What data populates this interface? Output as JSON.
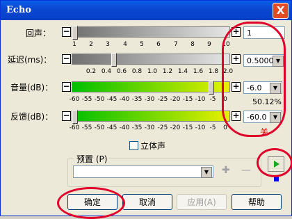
{
  "window": {
    "title": "Echo",
    "close_glyph": "X"
  },
  "rows": {
    "echo": {
      "label": "回声：",
      "value": "1",
      "scale": [
        "1",
        "2",
        "3",
        "4",
        "5",
        "6",
        "7",
        "8",
        "9",
        "10"
      ]
    },
    "delay": {
      "label": "延迟(ms)：",
      "value": "0.5000",
      "scale": [
        "0.2",
        "0.4",
        "0.6",
        "0.8",
        "1.0",
        "1.2",
        "1.4",
        "1.6",
        "1.8",
        "2.0"
      ]
    },
    "volume": {
      "label": "音量(dB)：",
      "value": "-6.0",
      "percent": "50.12%",
      "scale": [
        "-60",
        "-55",
        "-50",
        "-45",
        "-40",
        "-35",
        "-30",
        "-25",
        "-20",
        "-15",
        "-10",
        "-5",
        "0"
      ]
    },
    "feedback": {
      "label": "反馈(dB)：",
      "value": "-60.0",
      "annotation": "关",
      "scale": [
        "-60",
        "-55",
        "-50",
        "-45",
        "-40",
        "-35",
        "-30",
        "-25",
        "-20",
        "-15",
        "-10",
        "-5",
        "0"
      ]
    }
  },
  "stereo": {
    "label": "立体声"
  },
  "presets": {
    "label": "预置 (P)"
  },
  "buttons": {
    "ok": "确定",
    "cancel": "取消",
    "apply": "应用(A)",
    "help": "帮助"
  },
  "colors": {
    "title_bar": "#0a52dc",
    "green_start": "#00c000",
    "green_end": "#e8f000",
    "annotation_red": "#e0002a"
  }
}
